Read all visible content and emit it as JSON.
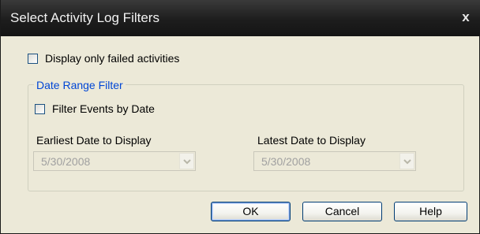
{
  "window": {
    "title": "Select Activity Log Filters",
    "close_glyph": "x",
    "close_icon": "close-icon"
  },
  "options": {
    "failed_only_label": "Display only failed activities",
    "failed_only_checked": false
  },
  "date_range": {
    "group_label": "Date Range Filter",
    "filter_by_date_label": "Filter Events by Date",
    "filter_by_date_checked": false,
    "earliest_label": "Earliest Date to Display",
    "earliest_value": "5/30/2008",
    "latest_label": "Latest Date to Display",
    "latest_value": "5/30/2008",
    "dropdown_icon": "chevron-down-icon",
    "enabled": false
  },
  "buttons": {
    "ok_label": "OK",
    "cancel_label": "Cancel",
    "help_label": "Help"
  },
  "colors": {
    "titlebar": "#1d1d1d",
    "title_text": "#f2f2f2",
    "dialog_bg": "#ece9d8",
    "group_label": "#0046d5",
    "disabled_text": "#a0a0a0",
    "button_border": "#003c74"
  }
}
